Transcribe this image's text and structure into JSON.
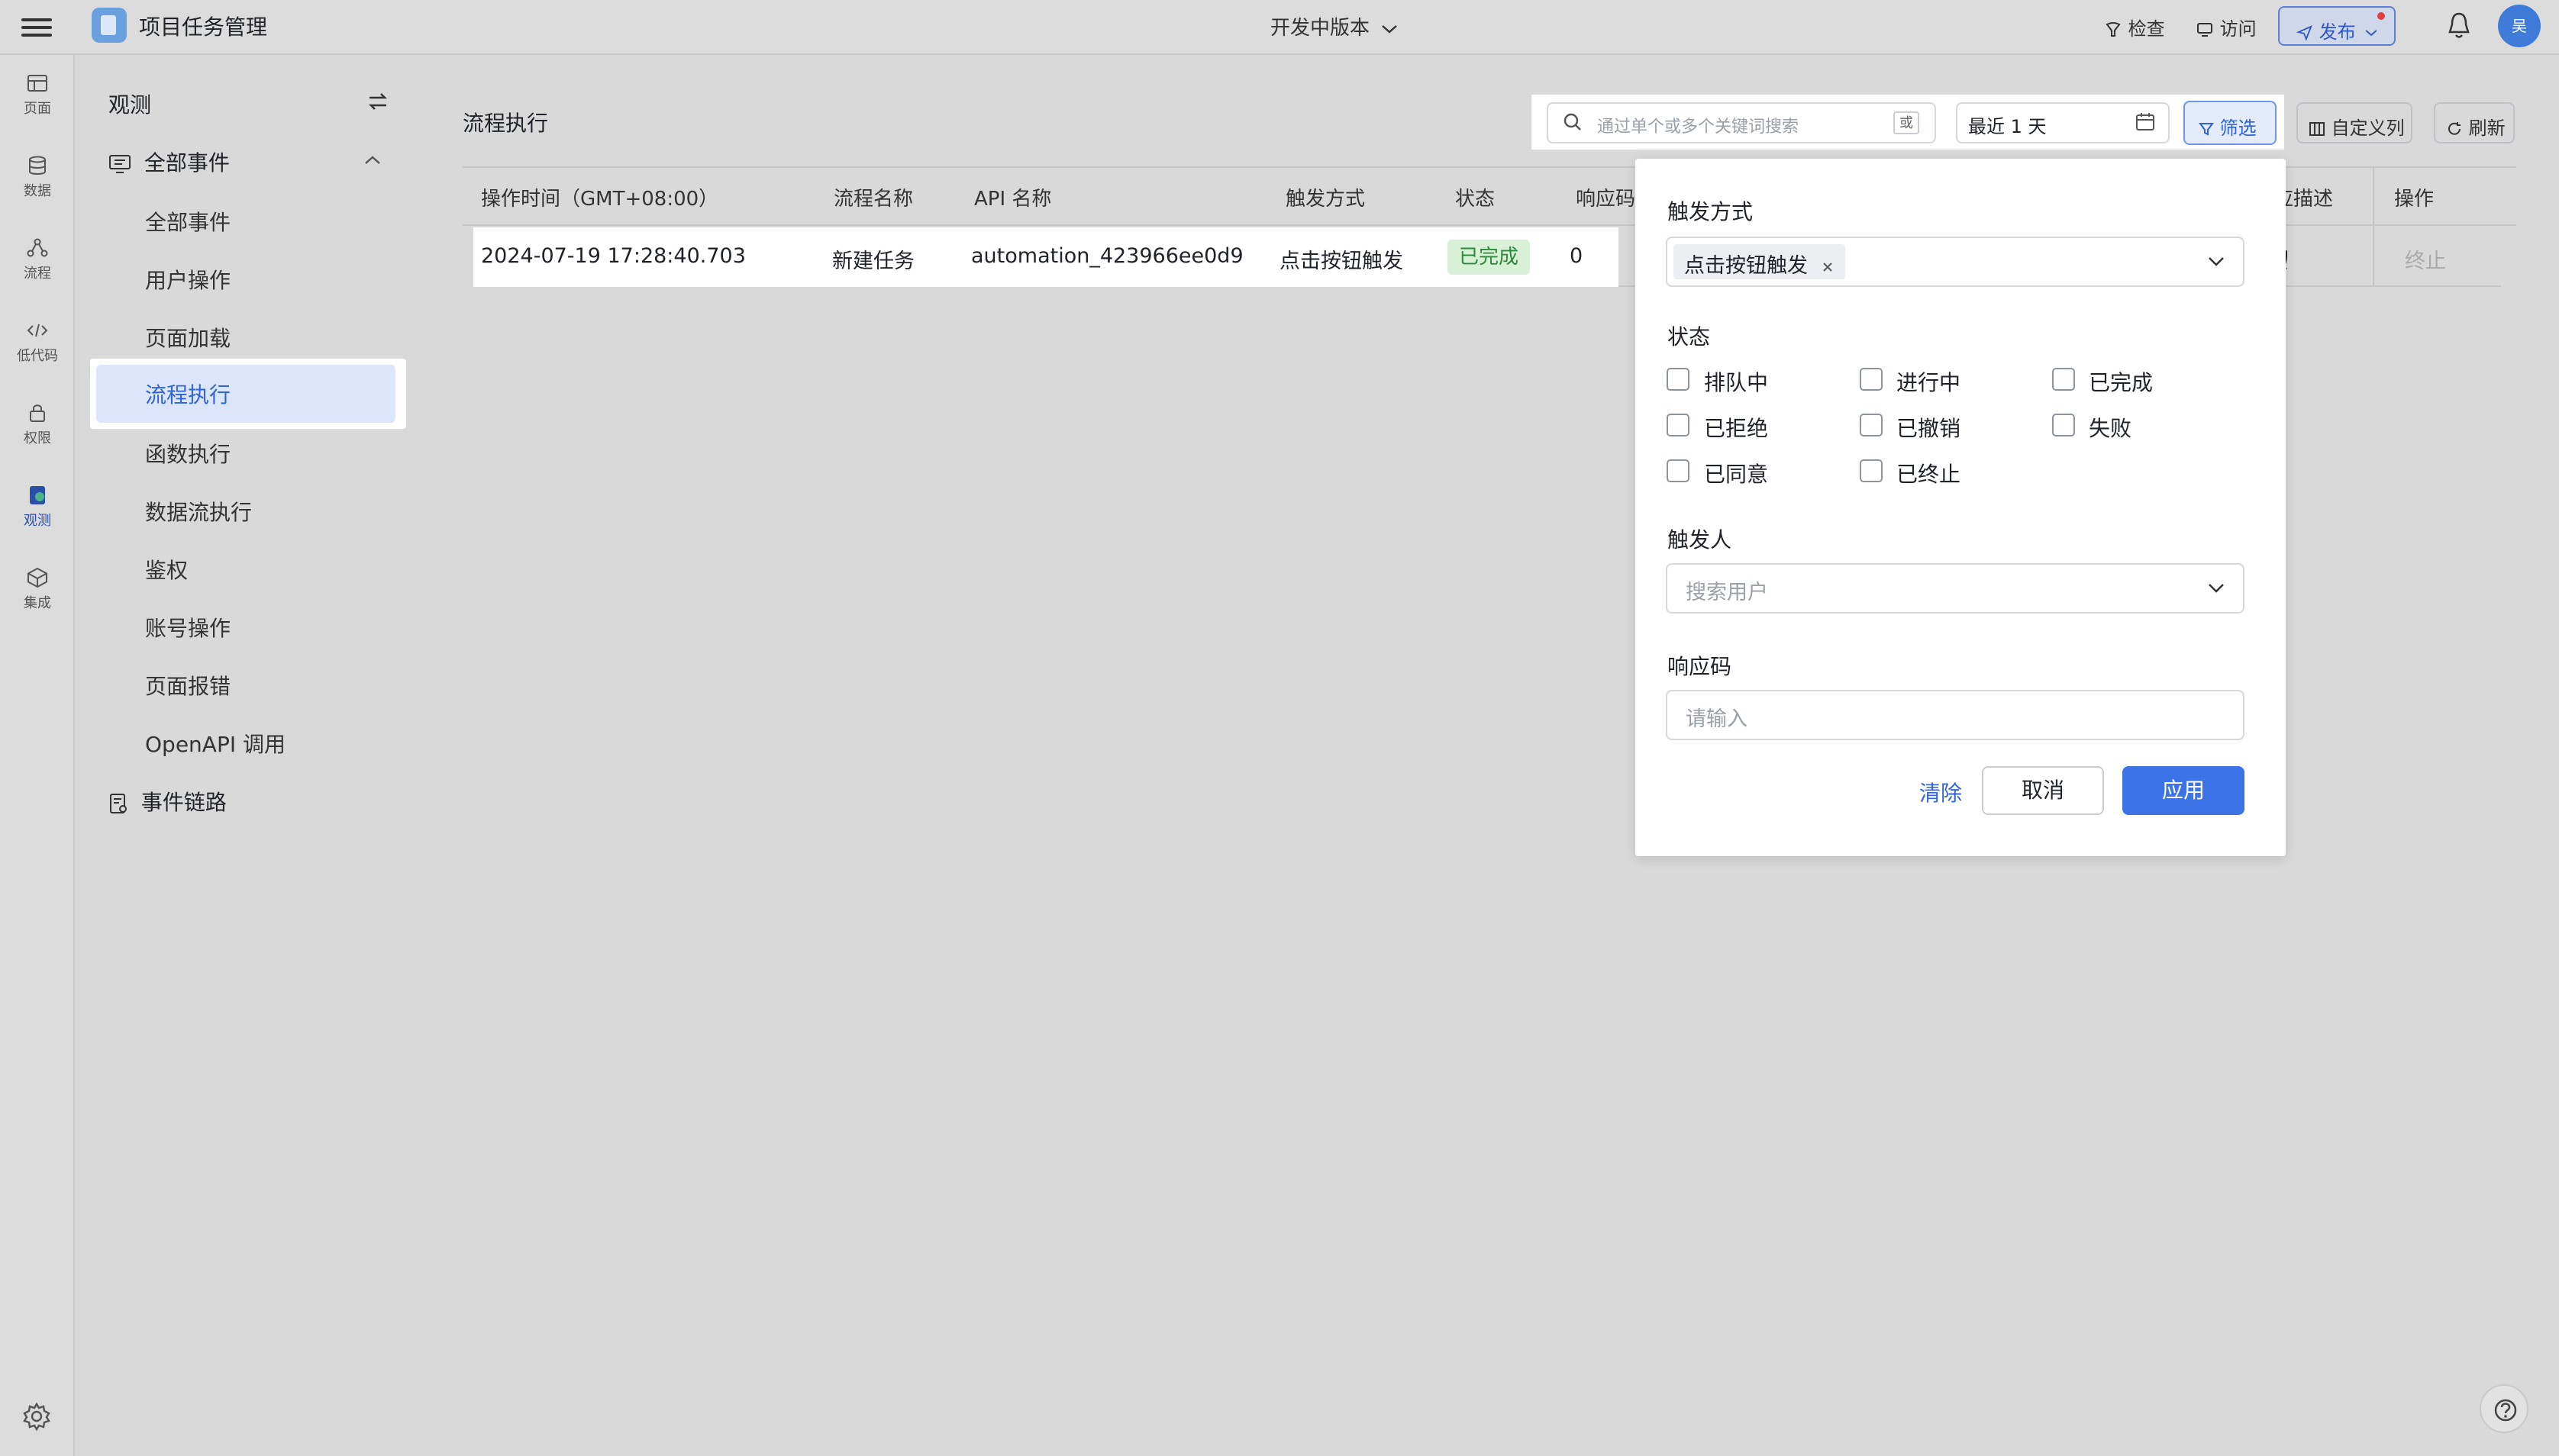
{
  "app": {
    "title": "项目任务管理",
    "version": "开发中版本"
  },
  "topbar": {
    "inspect": "检查",
    "visit": "访问",
    "publish": "发布",
    "avatar": "吴"
  },
  "rail": [
    {
      "label": "页面",
      "icon": "page-icon"
    },
    {
      "label": "数据",
      "icon": "database-icon"
    },
    {
      "label": "流程",
      "icon": "flow-icon"
    },
    {
      "label": "低代码",
      "icon": "code-icon"
    },
    {
      "label": "权限",
      "icon": "lock-icon"
    },
    {
      "label": "观测",
      "icon": "observe-icon"
    },
    {
      "label": "集成",
      "icon": "integration-icon"
    }
  ],
  "sidebar": {
    "title": "观测",
    "group": "全部事件",
    "items": [
      "全部事件",
      "用户操作",
      "页面加载",
      "流程执行",
      "函数执行",
      "数据流执行",
      "鉴权",
      "账号操作",
      "页面报错",
      "OpenAPI 调用"
    ],
    "active": "流程执行",
    "chain": "事件链路"
  },
  "main": {
    "title": "流程执行",
    "search_placeholder": "通过单个或多个关键词搜索",
    "or_label": "或",
    "date_range": "最近 1 天",
    "filter_label": "筛选",
    "custom_columns": "自定义列",
    "refresh": "刷新"
  },
  "table": {
    "headers": [
      "操作时间（GMT+08:00）",
      "流程名称",
      "API 名称",
      "触发方式",
      "状态",
      "响应码",
      "应描述",
      "操作"
    ],
    "rows": [
      {
        "time": "2024-07-19 17:28:40.703",
        "flow": "新建任务",
        "api": "automation_423966ee0d9",
        "trigger": "点击按钮触发",
        "status": "已完成",
        "code": "0",
        "desc_tail": "功",
        "action": "终止"
      }
    ]
  },
  "filter_panel": {
    "trigger_label": "触发方式",
    "trigger_tag": "点击按钮触发",
    "status_label": "状态",
    "statuses": [
      "排队中",
      "进行中",
      "已完成",
      "已拒绝",
      "已撤销",
      "失败",
      "已同意",
      "已终止"
    ],
    "trigger_user_label": "触发人",
    "user_placeholder": "搜索用户",
    "code_label": "响应码",
    "code_placeholder": "请输入",
    "clear": "清除",
    "cancel": "取消",
    "apply": "应用"
  },
  "colors": {
    "accent": "#3c74e8",
    "status_done_bg": "#d8f0d5",
    "status_done_fg": "#2e8a3c"
  }
}
